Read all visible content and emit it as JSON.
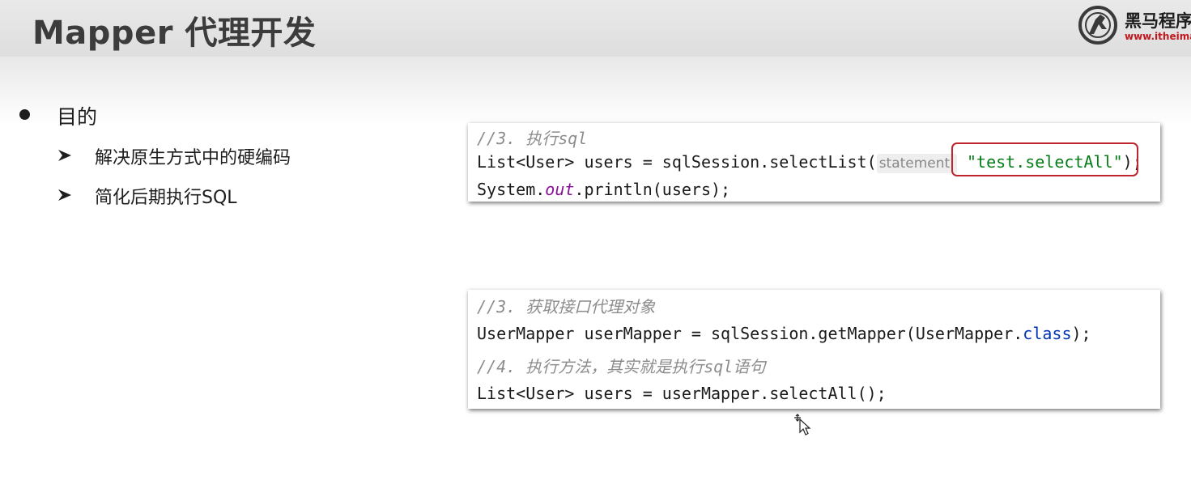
{
  "header": {
    "title": "Mapper 代理开发",
    "logo_name": "黑马程序",
    "logo_url": "www.itheima.c"
  },
  "content": {
    "bullet": "目的",
    "sub_items": [
      "解决原生方式中的硬编码",
      "简化后期执行SQL"
    ]
  },
  "code_block_1": {
    "comment": "//3. 执行sql",
    "line2_prefix": "List<User> users = sqlSession.selectList(",
    "param_hint": "statement:",
    "string_arg": "\"test.selectAll\"",
    "line2_suffix": ");",
    "line3_prefix": "System.",
    "line3_field": "out",
    "line3_suffix": ".println(users);"
  },
  "code_block_2": {
    "comment1": "//3. 获取接口代理对象",
    "line2_prefix": "UserMapper userMapper = sqlSession.getMapper(UserMapper.",
    "line2_keyword": "class",
    "line2_suffix": ");",
    "comment2": "//4. 执行方法，其实就是执行sql语句",
    "line4": "List<User> users = userMapper.selectAll();"
  },
  "colors": {
    "highlight_box": "#c0252f",
    "logo_red": "#c0181f",
    "string_green": "#067d17",
    "keyword_blue": "#0033b3",
    "field_purple": "#871094",
    "comment_gray": "#8c8c8c"
  }
}
